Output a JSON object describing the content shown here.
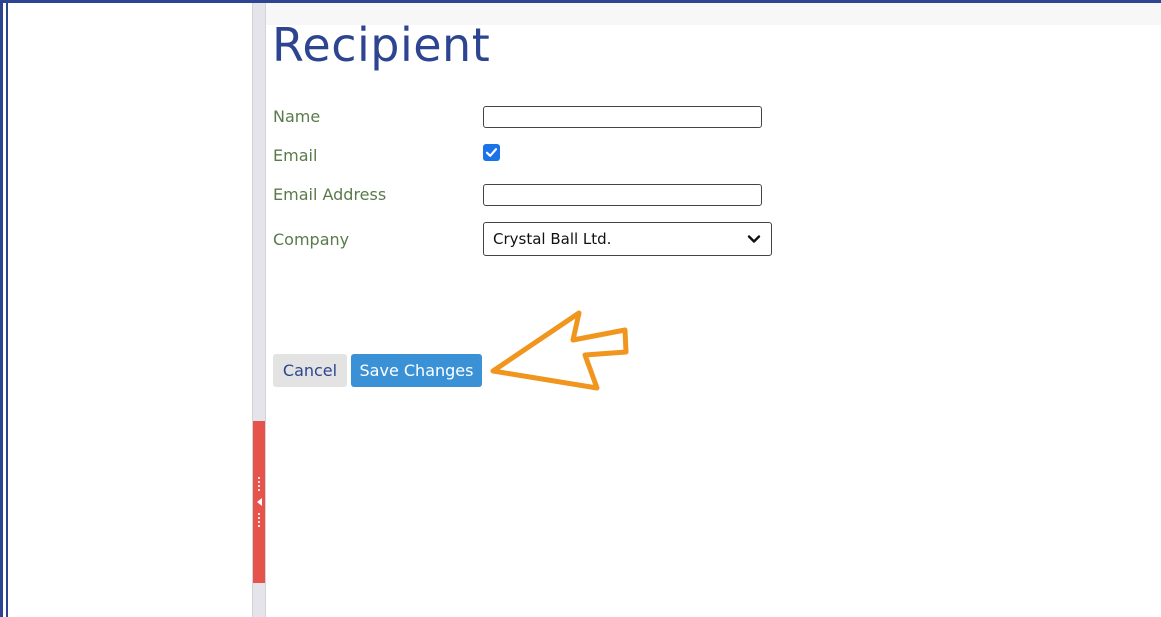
{
  "form": {
    "title": "Recipient",
    "fields": [
      {
        "label": "Name",
        "type": "text",
        "value": ""
      },
      {
        "label": "Email",
        "type": "checkbox",
        "checked": true
      },
      {
        "label": "Email Address",
        "type": "text",
        "value": ""
      },
      {
        "label": "Company",
        "type": "select",
        "value": "Crystal Ball Ltd."
      }
    ]
  },
  "actions": {
    "cancel_label": "Cancel",
    "save_label": "Save Changes"
  },
  "icons": {
    "checkbox": "checkmark-icon",
    "select": "chevron-down-icon",
    "splitter": "collapse-left-arrow-icon",
    "annotation": "pointer-arrow-icon"
  },
  "colors": {
    "title": "#2d4591",
    "label": "#5a7a4a",
    "save_button": "#3a91d6",
    "cancel_button": "#e3e3e3",
    "splitter_handle": "#e5534b",
    "annotation_arrow": "#f0961e"
  }
}
